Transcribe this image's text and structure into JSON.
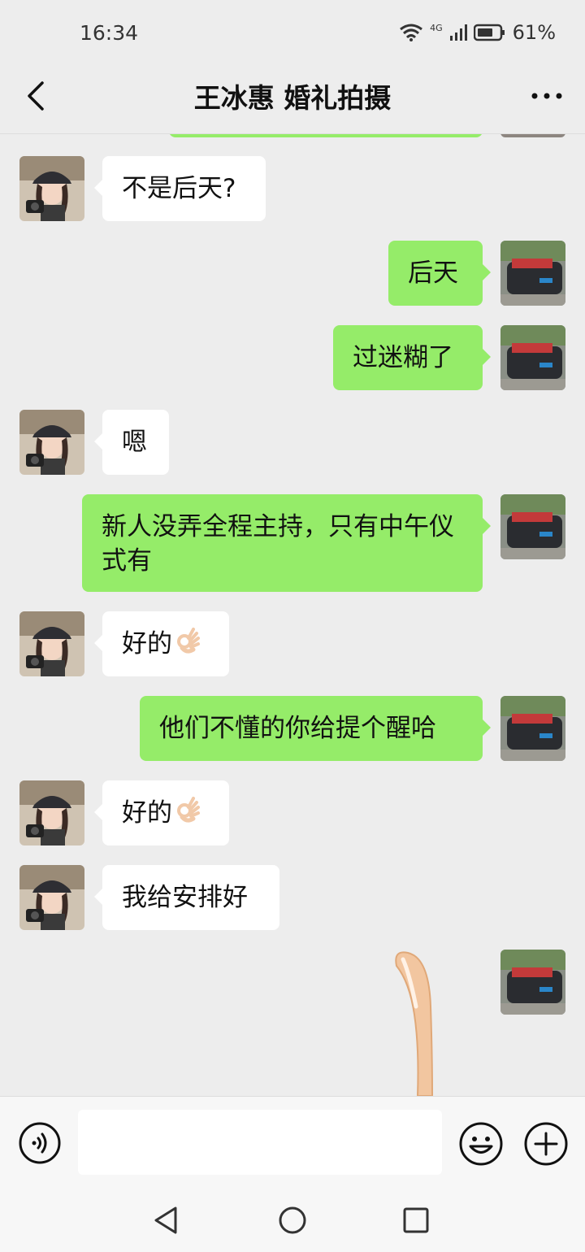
{
  "status_bar": {
    "time": "16:34",
    "network": "4G",
    "battery": "61%"
  },
  "header": {
    "title": "王冰惠 婚礼拍摄",
    "back_icon": "chevron-left-icon",
    "more_icon": "more-dots-icon"
  },
  "messages": [
    {
      "side": "in",
      "text": "不是后天?"
    },
    {
      "side": "out",
      "text": "后天"
    },
    {
      "side": "out",
      "text": "过迷糊了"
    },
    {
      "side": "in",
      "text": "嗯"
    },
    {
      "side": "out",
      "text": "新人没弄全程主持，只有中午仪式有"
    },
    {
      "side": "in",
      "text": "好的",
      "emoji": "ok-hand-emoji"
    },
    {
      "side": "out",
      "text": "他们不懂的你给提个醒哈"
    },
    {
      "side": "in",
      "text": "好的",
      "emoji": "ok-hand-emoji"
    },
    {
      "side": "in",
      "text": "我给安排好"
    },
    {
      "side": "out",
      "sticker": "cat-tail-sticker"
    }
  ],
  "input_bar": {
    "value": "",
    "voice_icon": "voice-icon",
    "emoji_icon": "smiley-icon",
    "plus_icon": "plus-icon"
  },
  "nav_bar": {
    "back": "nav-back-icon",
    "home": "nav-home-icon",
    "recents": "nav-recents-icon"
  },
  "colors": {
    "background": "#ededed",
    "outgoing_bubble": "#95ec69",
    "incoming_bubble": "#ffffff"
  }
}
